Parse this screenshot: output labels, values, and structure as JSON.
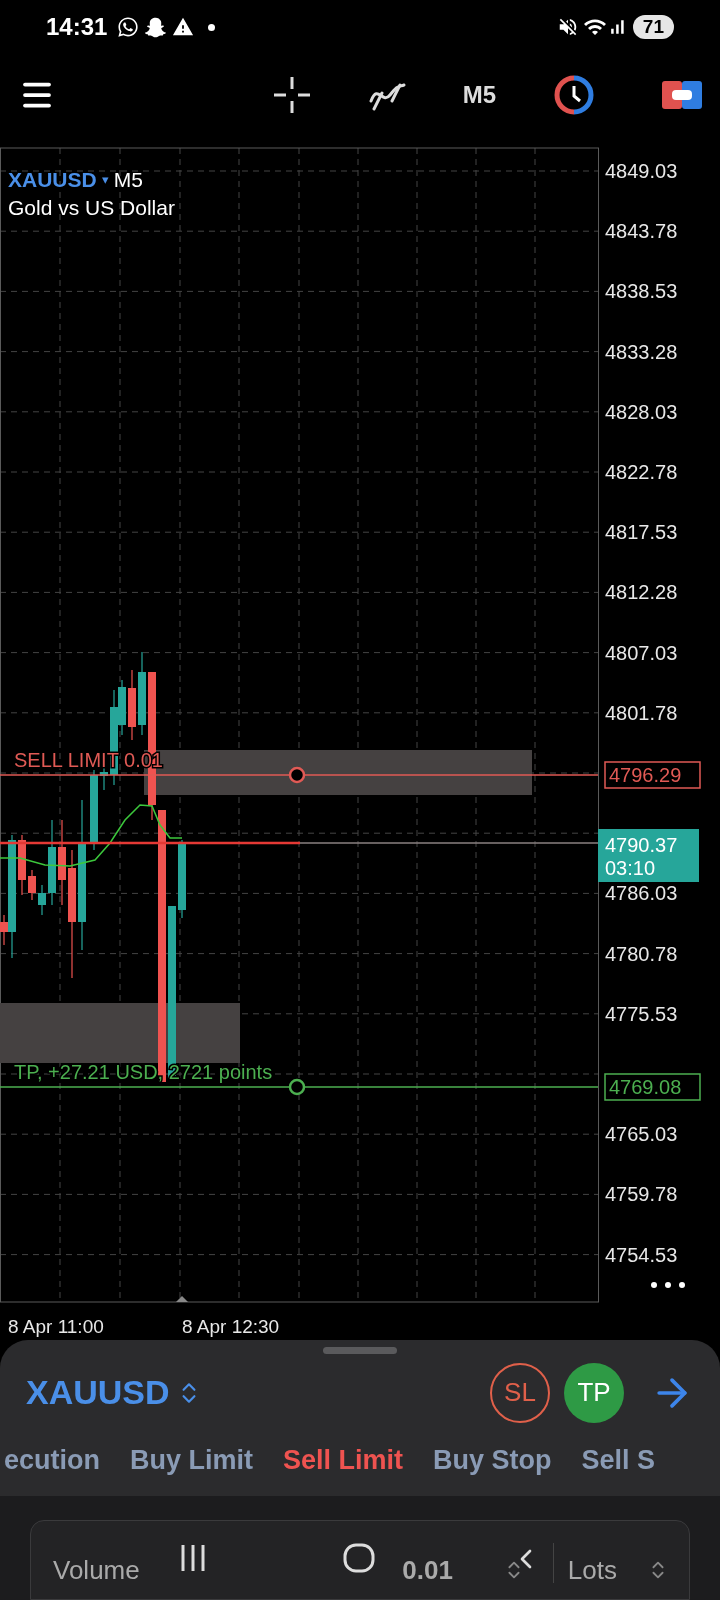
{
  "status_bar": {
    "time": "14:31",
    "battery": "71"
  },
  "toolbar": {
    "timeframe": "M5"
  },
  "chart": {
    "symbol": "XAUUSD",
    "caret": "▾",
    "timeframe": "M5",
    "description": "Gold vs US Dollar",
    "price_labels": [
      "4849.03",
      "4843.78",
      "4838.53",
      "4833.28",
      "4828.03",
      "4822.78",
      "4817.53",
      "4812.28",
      "4807.03",
      "4801.78",
      "4786.03",
      "4780.78",
      "4775.53",
      "4765.03",
      "4759.78",
      "4754.53"
    ],
    "time_labels": [
      "8 Apr 11:00",
      "8 Apr 12:30"
    ],
    "orders": [
      {
        "kind": "pending",
        "label": "SELL LIMIT 0.01",
        "price": "4796.29",
        "color": "#e05a55"
      },
      {
        "kind": "take_profit",
        "label": "TP, +27.21 USD, 2721 points",
        "price": "4769.08",
        "color": "#4caf50"
      }
    ],
    "bid": {
      "price": "4790.37",
      "countdown": "03:10"
    }
  },
  "order_panel": {
    "symbol": "XAUUSD",
    "sl": "SL",
    "tp": "TP",
    "tabs": [
      {
        "label": "ecution",
        "selected": false
      },
      {
        "label": "Buy Limit",
        "selected": false
      },
      {
        "label": "Sell Limit",
        "selected": true
      },
      {
        "label": "Buy Stop",
        "selected": false
      },
      {
        "label": "Sell S",
        "selected": false
      }
    ],
    "volume": {
      "label": "Volume",
      "value": "0.01",
      "unit": "Lots"
    }
  }
}
